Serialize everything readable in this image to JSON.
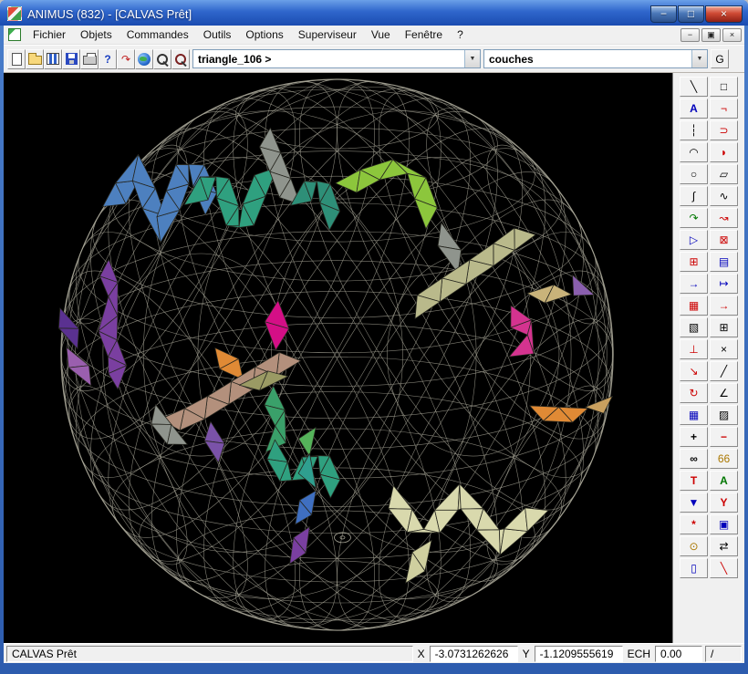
{
  "window": {
    "title": "ANIMUS (832) - [CALVAS Prêt]",
    "buttons": {
      "minimize": "−",
      "maximize": "□",
      "close": "×"
    }
  },
  "menu": {
    "items": [
      {
        "label": "Fichier"
      },
      {
        "label": "Objets"
      },
      {
        "label": "Commandes"
      },
      {
        "label": "Outils"
      },
      {
        "label": "Options"
      },
      {
        "label": "Superviseur"
      },
      {
        "label": "Vue"
      },
      {
        "label": "Fenêtre"
      },
      {
        "label": "?"
      }
    ]
  },
  "mdi": {
    "minimize": "−",
    "restore": "▣",
    "close": "×"
  },
  "toolbar": {
    "buttons": [
      {
        "name": "new-file-button",
        "css": "i-new"
      },
      {
        "name": "open-file-button",
        "css": "i-open"
      },
      {
        "name": "view-columns-button",
        "css": "i-pages"
      },
      {
        "name": "save-button",
        "css": "i-save"
      },
      {
        "name": "print-button",
        "css": "i-print"
      },
      {
        "name": "context-help-button",
        "glyph": "?",
        "color": "#1a3fc0",
        "bold": true
      },
      {
        "name": "redo-button",
        "glyph": "↷",
        "color": "#c02020"
      },
      {
        "name": "world-button",
        "css": "i-globe"
      },
      {
        "name": "zoom-button",
        "css": "i-zoom"
      },
      {
        "name": "zoom-previous-button",
        "css": "i-zoom2"
      }
    ],
    "combo1": {
      "value": "triangle_106 >"
    },
    "combo2": {
      "value": "couches"
    },
    "combo_arrow": "▼",
    "g_button": "G"
  },
  "right_panel": {
    "tools": [
      {
        "name": "line-icon",
        "glyph": "╲",
        "color": "#000000"
      },
      {
        "name": "rectangle-icon",
        "glyph": "□",
        "color": "#000000"
      },
      {
        "name": "text-icon",
        "glyph": "A",
        "color": "#0000bb",
        "bold": true
      },
      {
        "name": "corner-icon",
        "glyph": "¬",
        "color": "#cc0000"
      },
      {
        "name": "construction-line-icon",
        "glyph": "┆",
        "color": "#000000"
      },
      {
        "name": "arc-icon",
        "glyph": "⊃",
        "color": "#cc0000"
      },
      {
        "name": "arc-3pt-icon",
        "glyph": "◠",
        "color": "#000000"
      },
      {
        "name": "half-disc-icon",
        "glyph": "◗",
        "color": "#cc0000"
      },
      {
        "name": "circle-icon",
        "glyph": "○",
        "color": "#000000"
      },
      {
        "name": "parallelogram-icon",
        "glyph": "▱",
        "color": "#000000"
      },
      {
        "name": "spline-icon",
        "glyph": "∫",
        "color": "#000000"
      },
      {
        "name": "wave-icon",
        "glyph": "∿",
        "color": "#000000"
      },
      {
        "name": "curve-arrow-icon",
        "glyph": "↷",
        "color": "#007700"
      },
      {
        "name": "freehand-icon",
        "glyph": "↝",
        "color": "#cc0000"
      },
      {
        "name": "polygon-icon",
        "glyph": "▷",
        "color": "#0000bb"
      },
      {
        "name": "delete-icon",
        "glyph": "⊠",
        "color": "#cc0000"
      },
      {
        "name": "move-icon",
        "glyph": "⊞",
        "color": "#cc0000"
      },
      {
        "name": "copy-icon",
        "glyph": "▤",
        "color": "#0000bb"
      },
      {
        "name": "paste-icon",
        "glyph": "→",
        "color": "#0000bb",
        "bold": true
      },
      {
        "name": "import-icon",
        "glyph": "↦",
        "color": "#0000bb"
      },
      {
        "name": "array-icon",
        "glyph": "▦",
        "color": "#cc0000"
      },
      {
        "name": "export-icon",
        "glyph": "→",
        "color": "#cc0000",
        "bold": true
      },
      {
        "name": "tile-icon",
        "glyph": "▧",
        "color": "#000000"
      },
      {
        "name": "grid-icon",
        "glyph": "⊞",
        "color": "#000000"
      },
      {
        "name": "axes-icon",
        "glyph": "⊥",
        "color": "#cc0000"
      },
      {
        "name": "intersect-icon",
        "glyph": "×",
        "color": "#000000"
      },
      {
        "name": "point-icon",
        "glyph": "↘",
        "color": "#cc0000"
      },
      {
        "name": "slope-icon",
        "glyph": "╱",
        "color": "#000000"
      },
      {
        "name": "rotate-icon",
        "glyph": "↻",
        "color": "#cc0000"
      },
      {
        "name": "angle-icon",
        "glyph": "∠",
        "color": "#000000"
      },
      {
        "name": "table-icon",
        "glyph": "▦",
        "color": "#0000bb"
      },
      {
        "name": "hatch-icon",
        "glyph": "▨",
        "color": "#000000"
      },
      {
        "name": "plus-icon",
        "glyph": "+",
        "color": "#000000",
        "bold": true
      },
      {
        "name": "minus-icon",
        "glyph": "−",
        "color": "#cc0000",
        "bold": true
      },
      {
        "name": "binoculars-icon",
        "glyph": "∞",
        "color": "#000000",
        "bold": true
      },
      {
        "name": "digits-icon",
        "glyph": "66",
        "color": "#aa7700"
      },
      {
        "name": "text-edit-icon",
        "glyph": "T",
        "color": "#cc0000",
        "bold": true
      },
      {
        "name": "annotate-icon",
        "glyph": "A",
        "color": "#007700",
        "bold": true
      },
      {
        "name": "filter-icon",
        "glyph": "▼",
        "color": "#0000bb"
      },
      {
        "name": "branch-icon",
        "glyph": "Y",
        "color": "#cc0000",
        "bold": true
      },
      {
        "name": "star-icon",
        "glyph": "*",
        "color": "#cc0000",
        "bold": true
      },
      {
        "name": "new-window-icon",
        "glyph": "▣",
        "color": "#0000bb"
      },
      {
        "name": "clock-icon",
        "glyph": "⊙",
        "color": "#aa7700"
      },
      {
        "name": "swap-icon",
        "glyph": "⇄",
        "color": "#000000"
      },
      {
        "name": "cylinder-icon",
        "glyph": "▯",
        "color": "#0000bb"
      },
      {
        "name": "pen-icon",
        "glyph": "╲",
        "color": "#cc0000"
      }
    ]
  },
  "statusbar": {
    "ready": "CALVAS Prêt",
    "x_label": "X",
    "x_value": "-3.0731262626",
    "y_label": "Y",
    "y_value": "-1.1209555619",
    "ech_label": "ECH",
    "ech_value": "0.00",
    "slash": "/"
  },
  "canvas": {
    "background": "#000000",
    "wireframe_color": "#a6a496",
    "strips": {
      "steel_blue": "#4d80bf",
      "sea_green": "#2fa07f",
      "gray_top": "#8f948d",
      "teal_v": "#2e8f78",
      "chartreuse": "#8cc63c",
      "gray_mid": "#8f948d",
      "khaki_long": "#b9b98b",
      "magenta_c": "#d40f86",
      "orange_c": "#e08a35",
      "tan_long": "#b3907c",
      "olive_s": "#9a9a64",
      "green_v": "#3aa06a",
      "violet_s": "#7a52a8",
      "gray_left": "#8f948d",
      "purple_long": "#7a3fa0",
      "darkpurple_e": "#5a3190",
      "plum_e": "#9a5fae",
      "teal_m2": "#2fa07f",
      "green_seg": "#55b35a",
      "teal_seg": "#2f9f8f",
      "blue_seg": "#3f6fc0",
      "purple_seg": "#7a3fa0",
      "pale_w": "#d9d9ad",
      "pale_desc": "#cfcf9f",
      "pink_r": "#d4338f",
      "khaki_r": "#c9b37a",
      "purple_r": "#8a5fae",
      "orange_r": "#e08a35",
      "tan_r": "#c9a05f"
    }
  }
}
